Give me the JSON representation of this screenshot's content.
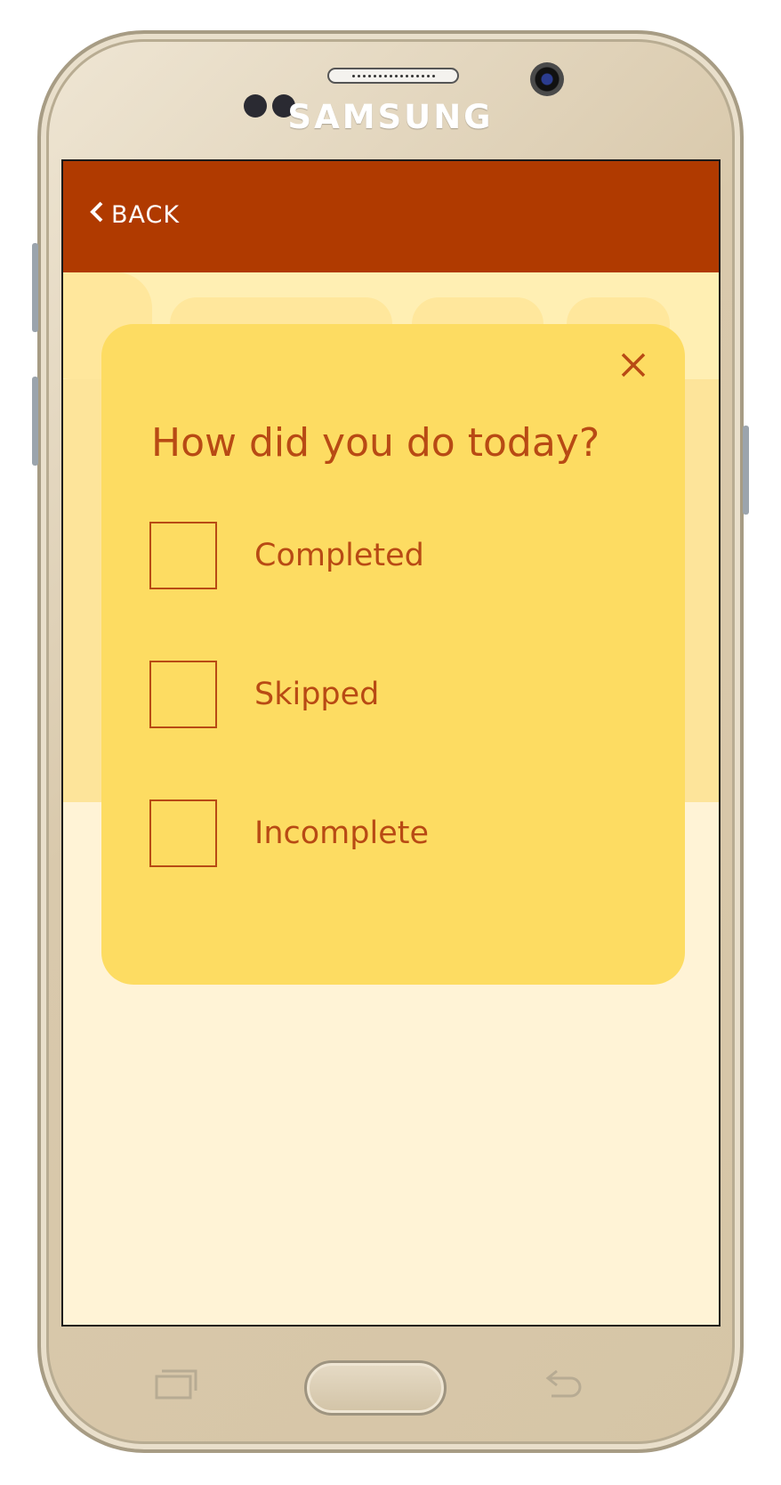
{
  "device": {
    "brand": "SAMSUNG"
  },
  "header": {
    "back_label": "BACK",
    "background_color": "#b03a00"
  },
  "modal": {
    "question": "How did you do today?",
    "options": [
      {
        "label": "Completed",
        "checked": false
      },
      {
        "label": "Skipped",
        "checked": false
      },
      {
        "label": "Incomplete",
        "checked": false
      }
    ],
    "background_color": "#fddc62",
    "accent_color": "#b84a14"
  },
  "icons": {
    "back": "chevron-left-icon",
    "close": "close-icon",
    "recent_apps": "recent-apps-icon",
    "back_nav": "back-arrow-icon"
  }
}
